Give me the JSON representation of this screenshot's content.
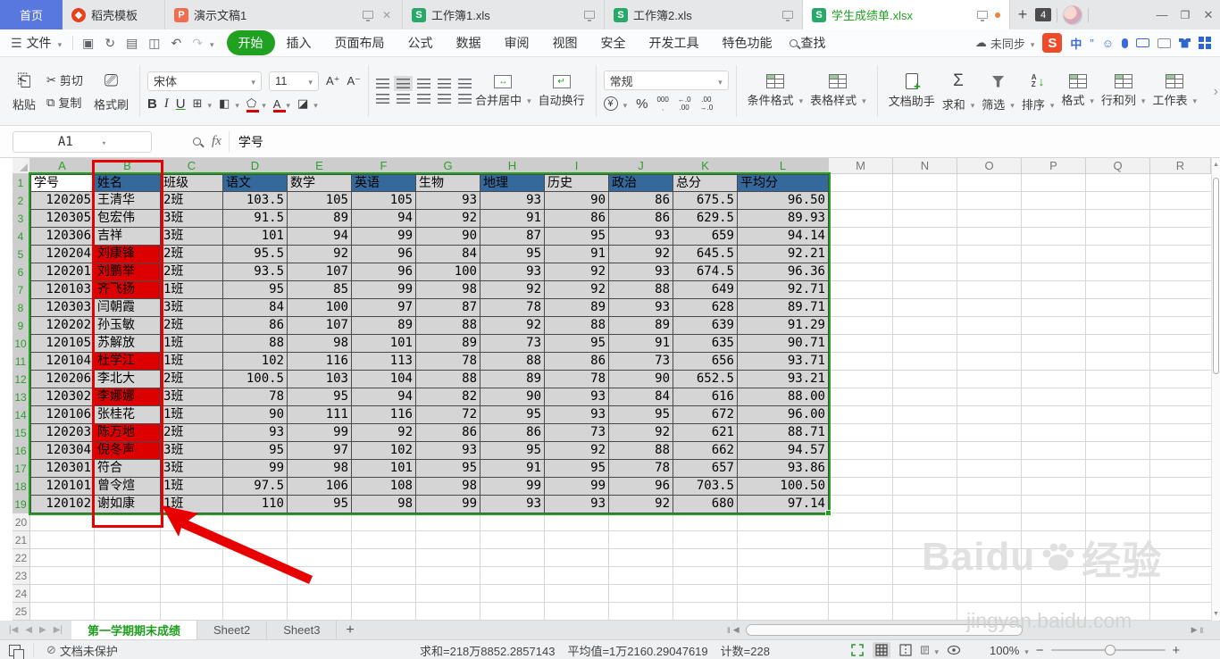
{
  "titlebar": {
    "home_tab": "首页",
    "tabs": [
      {
        "label": "稻壳模板"
      },
      {
        "label": "演示文稿1"
      },
      {
        "label": "工作簿1.xls"
      },
      {
        "label": "工作簿2.xls"
      },
      {
        "label": "学生成绩单.xlsx"
      }
    ],
    "tab_count_badge": "4"
  },
  "menubar": {
    "file": "文件",
    "tabs": [
      "开始",
      "插入",
      "页面布局",
      "公式",
      "数据",
      "审阅",
      "视图",
      "安全",
      "开发工具",
      "特色功能"
    ],
    "active_tab": "开始",
    "search": "查找",
    "sync": "未同步",
    "lang_badge": "中",
    "quote_badge": "”"
  },
  "ribbon": {
    "paste": "粘贴",
    "cut": "剪切",
    "copy": "复制",
    "format_painter": "格式刷",
    "font_name": "宋体",
    "font_size": "11",
    "bold": "B",
    "italic": "I",
    "underline": "U",
    "merge_center": "合并居中",
    "wrap_text": "自动换行",
    "number_format": "常规",
    "percent": "%",
    "thousands": "000",
    "dec_inc_top": "←.0",
    "dec_inc_bot": ".00",
    "dec_dec_top": ".00",
    "dec_dec_bot": "→.0",
    "currency": "¥",
    "conditional_format": "条件格式",
    "table_style": "表格样式",
    "doc_assistant": "文档助手",
    "sum": "求和",
    "filter": "筛选",
    "sort": "排序",
    "format": "格式",
    "rows_cols": "行和列",
    "worksheet": "工作表",
    "sort_a": "A",
    "sort_z": "Z",
    "sum_sigma": "Σ"
  },
  "formula_bar": {
    "name_box": "A1",
    "fx": "fx",
    "content": "学号"
  },
  "sheet": {
    "columns": [
      "A",
      "B",
      "C",
      "D",
      "E",
      "F",
      "G",
      "H",
      "I",
      "J",
      "K",
      "L",
      "M",
      "N",
      "O",
      "P",
      "Q",
      "R"
    ],
    "selected_columns_count": 12,
    "rows_visible": 25,
    "selected_rows_count": 19,
    "table": {
      "headers": [
        "学号",
        "姓名",
        "班级",
        "语文",
        "数学",
        "英语",
        "生物",
        "地理",
        "历史",
        "政治",
        "总分",
        "平均分"
      ],
      "rows": [
        {
          "cells": [
            "120205",
            "王清华",
            "2班",
            "103.5",
            "105",
            "105",
            "93",
            "93",
            "90",
            "86",
            "675.5",
            "96.50"
          ],
          "red_name": false
        },
        {
          "cells": [
            "120305",
            "包宏伟",
            "3班",
            "91.5",
            "89",
            "94",
            "92",
            "91",
            "86",
            "86",
            "629.5",
            "89.93"
          ],
          "red_name": false
        },
        {
          "cells": [
            "120306",
            "吉祥",
            "3班",
            "101",
            "94",
            "99",
            "90",
            "87",
            "95",
            "93",
            "659",
            "94.14"
          ],
          "red_name": false
        },
        {
          "cells": [
            "120204",
            "刘康锋",
            "2班",
            "95.5",
            "92",
            "96",
            "84",
            "95",
            "91",
            "92",
            "645.5",
            "92.21"
          ],
          "red_name": true
        },
        {
          "cells": [
            "120201",
            "刘鹏举",
            "2班",
            "93.5",
            "107",
            "96",
            "100",
            "93",
            "92",
            "93",
            "674.5",
            "96.36"
          ],
          "red_name": true
        },
        {
          "cells": [
            "120103",
            "齐飞扬",
            "1班",
            "95",
            "85",
            "99",
            "98",
            "92",
            "92",
            "88",
            "649",
            "92.71"
          ],
          "red_name": true
        },
        {
          "cells": [
            "120303",
            "闫朝霞",
            "3班",
            "84",
            "100",
            "97",
            "87",
            "78",
            "89",
            "93",
            "628",
            "89.71"
          ],
          "red_name": false
        },
        {
          "cells": [
            "120202",
            "孙玉敏",
            "2班",
            "86",
            "107",
            "89",
            "88",
            "92",
            "88",
            "89",
            "639",
            "91.29"
          ],
          "red_name": false
        },
        {
          "cells": [
            "120105",
            "苏解放",
            "1班",
            "88",
            "98",
            "101",
            "89",
            "73",
            "95",
            "91",
            "635",
            "90.71"
          ],
          "red_name": false
        },
        {
          "cells": [
            "120104",
            "杜学江",
            "1班",
            "102",
            "116",
            "113",
            "78",
            "88",
            "86",
            "73",
            "656",
            "93.71"
          ],
          "red_name": true
        },
        {
          "cells": [
            "120206",
            "李北大",
            "2班",
            "100.5",
            "103",
            "104",
            "88",
            "89",
            "78",
            "90",
            "652.5",
            "93.21"
          ],
          "red_name": false
        },
        {
          "cells": [
            "120302",
            "李娜娜",
            "3班",
            "78",
            "95",
            "94",
            "82",
            "90",
            "93",
            "84",
            "616",
            "88.00"
          ],
          "red_name": true
        },
        {
          "cells": [
            "120106",
            "张桂花",
            "1班",
            "90",
            "111",
            "116",
            "72",
            "95",
            "93",
            "95",
            "672",
            "96.00"
          ],
          "red_name": false
        },
        {
          "cells": [
            "120203",
            "陈万地",
            "2班",
            "93",
            "99",
            "92",
            "86",
            "86",
            "73",
            "92",
            "621",
            "88.71"
          ],
          "red_name": true
        },
        {
          "cells": [
            "120304",
            "倪冬声",
            "3班",
            "95",
            "97",
            "102",
            "93",
            "95",
            "92",
            "88",
            "662",
            "94.57"
          ],
          "red_name": true
        },
        {
          "cells": [
            "120301",
            "符合",
            "3班",
            "99",
            "98",
            "101",
            "95",
            "91",
            "95",
            "78",
            "657",
            "93.86"
          ],
          "red_name": false
        },
        {
          "cells": [
            "120101",
            "曾令煊",
            "1班",
            "97.5",
            "106",
            "108",
            "98",
            "99",
            "99",
            "96",
            "703.5",
            "100.50"
          ],
          "red_name": false
        },
        {
          "cells": [
            "120102",
            "谢如康",
            "1班",
            "110",
            "95",
            "98",
            "99",
            "93",
            "93",
            "92",
            "680",
            "97.14"
          ],
          "red_name": false
        }
      ]
    }
  },
  "sheet_bar": {
    "tabs": [
      {
        "label": "第一学期期末成绩",
        "active": true
      },
      {
        "label": "Sheet2",
        "active": false
      },
      {
        "label": "Sheet3",
        "active": false
      }
    ]
  },
  "status_bar": {
    "protection": "文档未保护",
    "sum": "求和=218万8852.2857143",
    "average": "平均值=1万2160.29047619",
    "count": "计数=228",
    "zoom": "100%"
  },
  "watermark": {
    "brand": "Baidu",
    "suffix": "经验",
    "url": "jingyan.baidu.com"
  },
  "colors": {
    "header_blue": "#35699B",
    "highlight_red": "#DC0000",
    "selection_green": "#1CA51C",
    "active_tab_green": "#21A121",
    "home_tab_blue": "#5878E0",
    "selection_gray": "#D5D5D5"
  }
}
